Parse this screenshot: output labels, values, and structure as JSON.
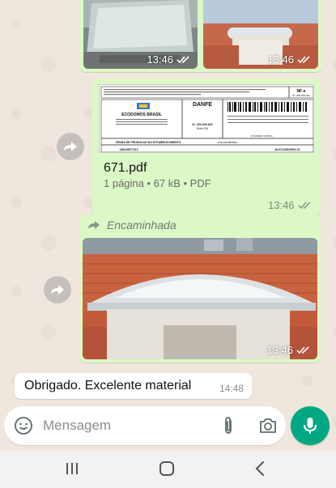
{
  "messages": {
    "photo_top_left": {
      "time": "13:46"
    },
    "photo_top_right": {
      "time": "13:46"
    },
    "document": {
      "file_name": "671.pdf",
      "meta": "1 página • 67 kB • PDF",
      "time": "13:46",
      "preview": {
        "danfe_title": "DANFE",
        "nfe_label": "NF-e",
        "number": "Nº. 000.000.632",
        "serie": "Série 001",
        "company": "ECODOMOS BRASIL",
        "operation": "VENDA DE PRODUCAO DO ESTABELECIMENTO",
        "code_a": "136319977113",
        "code_b": "46.574.652/0001-01",
        "protocol": "125242325855061",
        "protocol_date": "17/10/2024 13:28:01"
      }
    },
    "forwarded": {
      "label": "Encaminhada",
      "time": "13:46"
    },
    "incoming": {
      "text": "Obrigado.  Excelente material",
      "time": "14:48"
    }
  },
  "composer": {
    "placeholder": "Mensagem"
  },
  "icons": {
    "emoji": "smiley-icon",
    "attach": "paperclip-icon",
    "camera": "camera-icon",
    "mic": "microphone-icon",
    "forward": "forward-icon"
  },
  "colors": {
    "outgoing_bubble": "#dcf8c6",
    "incoming_bubble": "#ffffff",
    "accent": "#00a884",
    "wallpaper": "#efe7dd"
  }
}
